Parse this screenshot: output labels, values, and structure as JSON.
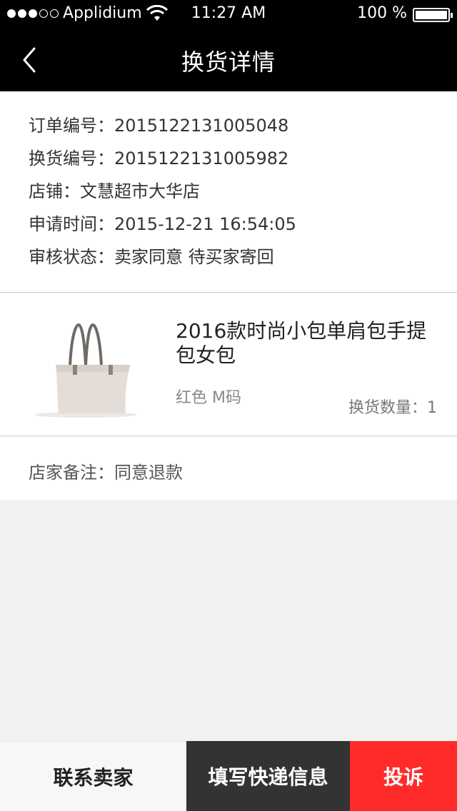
{
  "status_bar": {
    "carrier": "Applidium",
    "time": "11:27 AM",
    "battery": "100 %"
  },
  "nav": {
    "title": "换货详情",
    "back_icon": "chevron-left-icon"
  },
  "order_info": {
    "order_no": "订单编号：2015122131005048",
    "exchange_no": "换货编号：2015122131005982",
    "store": "店铺：文慧超市大华店",
    "apply_time": "申请时间：2015-12-21 16:54:05",
    "review_status": "审核状态：卖家同意 待买家寄回"
  },
  "product": {
    "name": "2016款时尚小包单肩包手提包女包",
    "variant": "红色 M码",
    "quantity": "换货数量：1"
  },
  "note": {
    "text": "店家备注：同意退款"
  },
  "actions": {
    "contact": "联系卖家",
    "shipping": "填写快递信息",
    "complain": "投诉"
  },
  "colors": {
    "nav_bg": "#000000",
    "complain_bg": "#ff2b2b",
    "shipping_bg": "#333333"
  }
}
